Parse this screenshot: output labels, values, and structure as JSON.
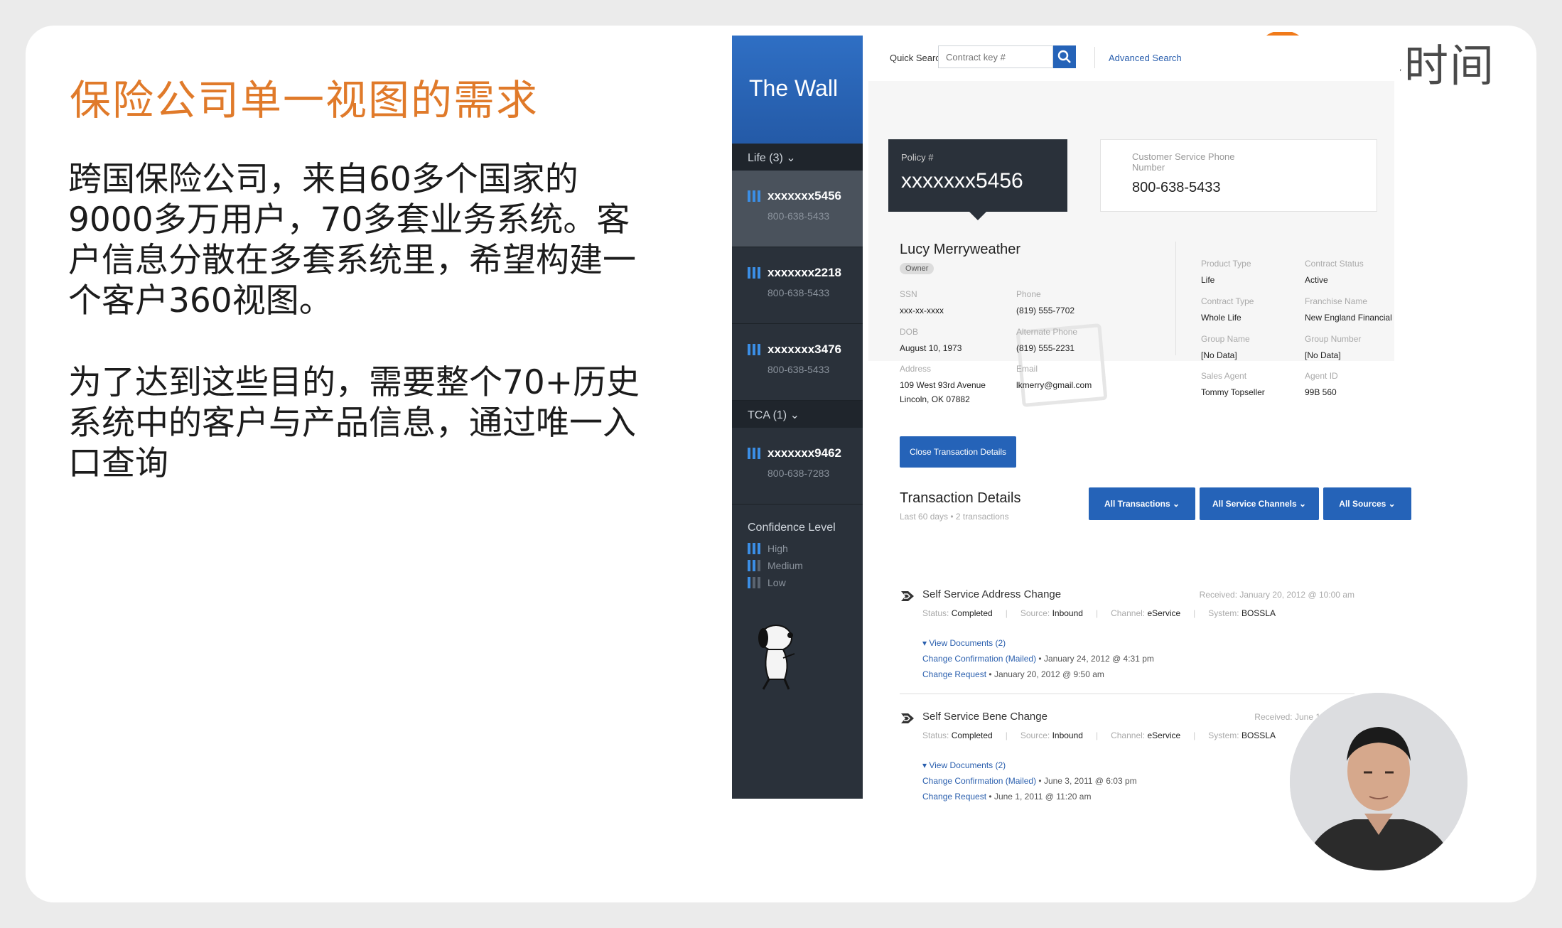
{
  "slide": {
    "title": "保险公司单一视图的需求",
    "para1": "跨国保险公司，来自60多个国家的9000多万用户，70多套业务系统。客户信息分散在多套系统里，希望构建一个客户360视图。",
    "para2": "为了达到这些目的，需要整个70+历史系统中的客户与产品信息，通过唯一入口查询"
  },
  "logo": {
    "text": "极客时间",
    "icon": "geektime-logo-icon"
  },
  "app": {
    "brand": "The Wall",
    "sidebar": {
      "groups": [
        {
          "label": "Life (3) ⌄",
          "accounts": [
            {
              "number": "xxxxxxx5456",
              "phone": "800-638-5433",
              "active": true
            },
            {
              "number": "xxxxxxx2218",
              "phone": "800-638-5433",
              "active": false
            },
            {
              "number": "xxxxxxx3476",
              "phone": "800-638-5433",
              "active": false
            }
          ]
        },
        {
          "label": "TCA (1) ⌄",
          "accounts": [
            {
              "number": "xxxxxxx9462",
              "phone": "800-638-7283",
              "active": false
            }
          ]
        }
      ],
      "confidence_title": "Confidence Level",
      "confidence_levels": [
        "High",
        "Medium",
        "Low"
      ]
    },
    "search": {
      "label": "Quick Search",
      "placeholder": "Contract key #",
      "advanced": "Advanced Search"
    },
    "policy": {
      "label": "Policy #",
      "value": "xxxxxxx5456"
    },
    "customer_service": {
      "label": "Customer Service Phone Number",
      "value": "800-638-5433"
    },
    "customer": {
      "name": "Lucy Merryweather",
      "role": "Owner",
      "ssn_label": "SSN",
      "ssn": "xxx-xx-xxxx",
      "dob_label": "DOB",
      "dob": "August 10, 1973",
      "address_label": "Address",
      "address1": "109 West 93rd Avenue",
      "address2": "Lincoln, OK 07882",
      "phone_label": "Phone",
      "phone": "(819) 555-7702",
      "alt_phone_label": "Alternate Phone",
      "alt_phone": "(819) 555-2231",
      "email_label": "Email",
      "email": "lkmerry@gmail.com"
    },
    "product": {
      "product_type_label": "Product Type",
      "product_type": "Life",
      "contract_status_label": "Contract Status",
      "contract_status": "Active",
      "contract_type_label": "Contract Type",
      "contract_type": "Whole Life",
      "franchise_label": "Franchise Name",
      "franchise": "New England Financial",
      "group_name_label": "Group Name",
      "group_name": "[No Data]",
      "group_number_label": "Group Number",
      "group_number": "[No Data]",
      "sales_agent_label": "Sales Agent",
      "sales_agent": "Tommy Topseller",
      "agent_id_label": "Agent ID",
      "agent_id": "99B 560"
    },
    "close_button": "Close Transaction Details",
    "transactions": {
      "title": "Transaction Details",
      "subtitle": "Last 60 days • 2 transactions",
      "filters": [
        "All Transactions ⌄",
        "All Service Channels ⌄",
        "All Sources ⌄"
      ],
      "items": [
        {
          "title": "Self Service Address Change",
          "received": "Received: January 20, 2012 @ 10:00 am",
          "status_k": "Status:",
          "status": "Completed",
          "source_k": "Source:",
          "source": "Inbound",
          "channel_k": "Channel:",
          "channel": "eService",
          "system_k": "System:",
          "system": "BOSSLA",
          "view_docs": "▾ View Documents (2)",
          "doc1_link": "Change Confirmation (Mailed)",
          "doc1_date": " • January 24, 2012 @ 4:31 pm",
          "doc2_link": "Change Request",
          "doc2_date": " • January 20, 2012 @ 9:50 am"
        },
        {
          "title": "Self Service Bene Change",
          "received": "Received: June 1, 2011 @",
          "status_k": "Status:",
          "status": "Completed",
          "source_k": "Source:",
          "source": "Inbound",
          "channel_k": "Channel:",
          "channel": "eService",
          "system_k": "System:",
          "system": "BOSSLA",
          "view_docs": "▾ View Documents (2)",
          "doc1_link": "Change Confirmation (Mailed)",
          "doc1_date": " • June 3, 2011 @ 6:03 pm",
          "doc2_link": "Change Request",
          "doc2_date": " • June 1, 2011 @ 11:20 am"
        }
      ]
    }
  },
  "colors": {
    "accent": "#e07a2a",
    "app_blue": "#2563b8",
    "sidebar": "#2a313a"
  }
}
